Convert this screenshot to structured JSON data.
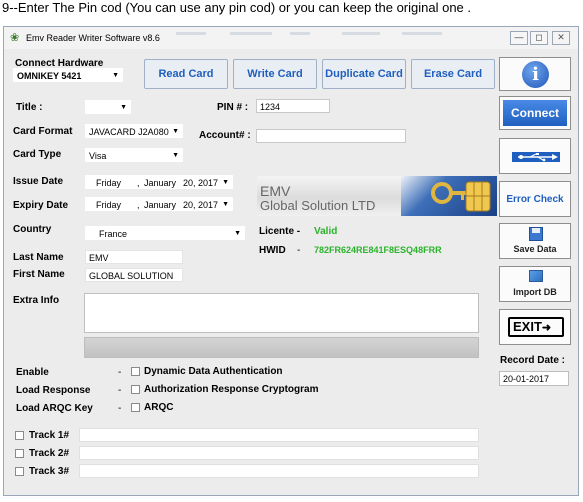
{
  "caption": "9--Enter The Pin cod (You can use any pin cod) or you can keep the original one .",
  "window": {
    "title": "Emv Reader Writer Software v8.6",
    "minimize": "—",
    "maximize": "◻",
    "close": "✕"
  },
  "hardware": {
    "label": "Connect Hardware",
    "value": "OMNIKEY 5421"
  },
  "toolbar": {
    "read": "Read Card",
    "write": "Write Card",
    "duplicate": "Duplicate Card",
    "erase": "Erase Card"
  },
  "form": {
    "title_label": "Title :",
    "title_value": "",
    "pin_label": "PIN # :",
    "pin_value": "1234",
    "card_format_label": "Card Format",
    "card_format_value": "JAVACARD J2A080",
    "account_label": "Account# :",
    "account_value": "",
    "card_type_label": "Card Type",
    "card_type_value": "Visa",
    "issue_date_label": "Issue Date",
    "issue_date": {
      "weekday": "Friday",
      "sep": ",",
      "month": "January",
      "date": "20, 2017"
    },
    "expiry_date_label": "Expiry Date",
    "expiry_date": {
      "weekday": "Friday",
      "sep": ",",
      "month": "January",
      "date": "20, 2017"
    },
    "country_label": "Country",
    "country_value": "France",
    "last_name_label": "Last Name",
    "last_name_value": "EMV",
    "first_name_label": "First Name",
    "first_name_value": "GLOBAL SOLUTION",
    "extra_info_label": "Extra Info",
    "extra_info_value": ""
  },
  "banner": {
    "line1": "EMV",
    "line2": "Global Solution LTD"
  },
  "license": {
    "label": "Licente -",
    "value": "Valid",
    "hwid_label": "HWID",
    "hwid_sep": "-",
    "hwid_value": "782FR624RE841F8ESQ48FRR"
  },
  "options": [
    {
      "label": "Enable",
      "sep": "-",
      "check_label": "Dynamic Data Authentication"
    },
    {
      "label": "Load Response",
      "sep": "-",
      "check_label": "Authorization Response Cryptogram"
    },
    {
      "label": "Load ARQC Key",
      "sep": "-",
      "check_label": "ARQC"
    }
  ],
  "tracks": [
    {
      "label": "Track 1#",
      "value": ""
    },
    {
      "label": "Track 2#",
      "value": ""
    },
    {
      "label": "Track 3#",
      "value": ""
    }
  ],
  "sidebar": {
    "info_icon": "i",
    "connect": "Connect",
    "error_check": "Error Check",
    "save_data": "Save Data",
    "import_db": "Import DB",
    "exit": "EXIT"
  },
  "record_date": {
    "label": "Record Date :",
    "value": "20-01-2017"
  },
  "colors": {
    "accent_blue": "#1f5fbf",
    "connect_blue": "#2a6fd6",
    "valid_green": "#2bb32b"
  }
}
